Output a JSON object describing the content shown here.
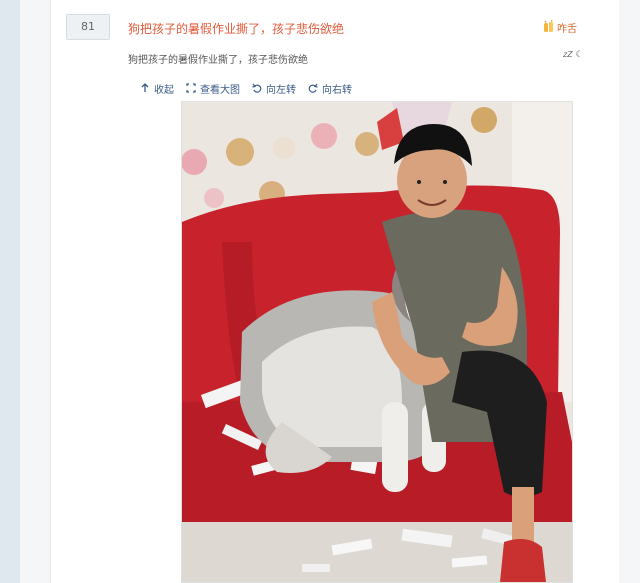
{
  "floor": "81",
  "post": {
    "title": "狗把孩子的暑假作业撕了，孩子悲伤欲绝",
    "description": "狗把孩子的暑假作业撕了，孩子悲伤欲绝"
  },
  "reaction": {
    "label": "咋舌",
    "icon": "clap-hands-icon"
  },
  "sleep_emoticon": "zZ",
  "toolbar": {
    "collapse": "收起",
    "view_large": "查看大图",
    "rotate_left": "向左转",
    "rotate_right": "向右转"
  },
  "colors": {
    "title": "#e05a3a",
    "link": "#3a5a8a",
    "sofa": "#c8232d"
  }
}
